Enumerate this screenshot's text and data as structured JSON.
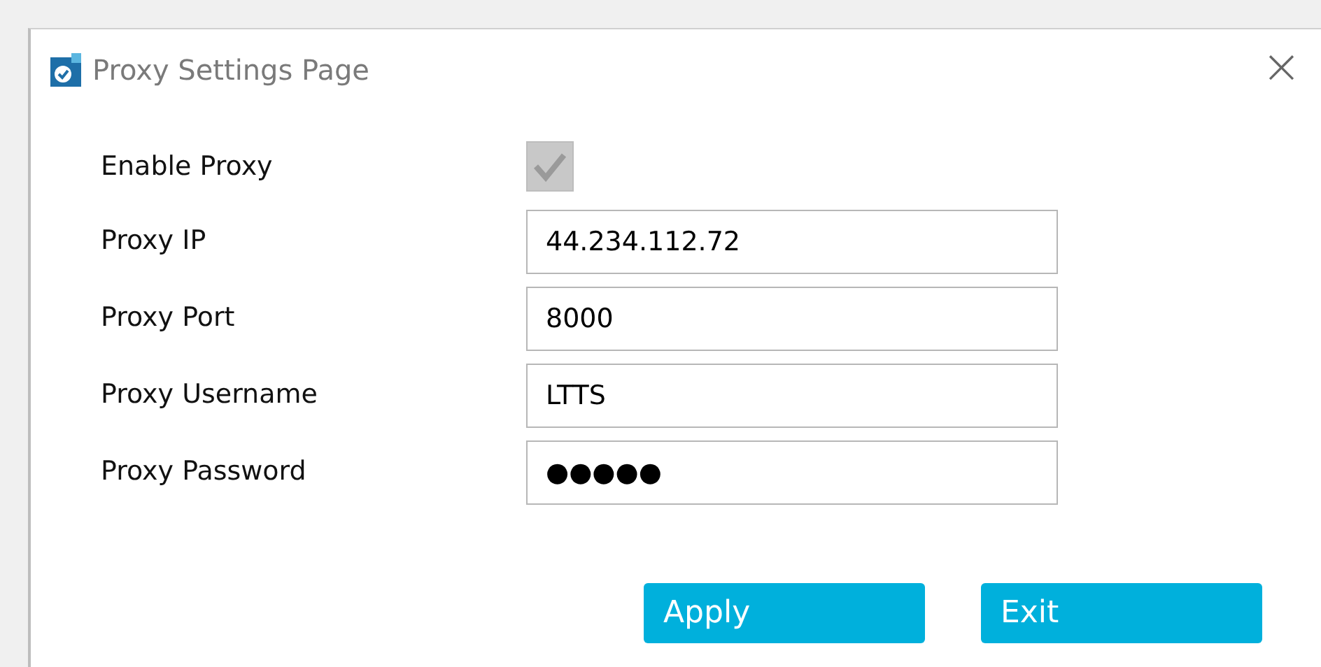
{
  "window": {
    "title": "Proxy Settings Page",
    "close": "×"
  },
  "fields": [
    {
      "kind": "checkbox",
      "label": "Enable Proxy",
      "checked": true,
      "disabled": true
    },
    {
      "kind": "text",
      "label": "Proxy IP",
      "value": "44.234.112.72"
    },
    {
      "kind": "text",
      "label": "Proxy Port",
      "value": "8000"
    },
    {
      "kind": "text",
      "label": "Proxy Username",
      "value": "LTTS"
    },
    {
      "kind": "text",
      "label": "Proxy Password",
      "value": "●●●●●"
    }
  ],
  "buttons": [
    "Apply",
    "Exit"
  ]
}
